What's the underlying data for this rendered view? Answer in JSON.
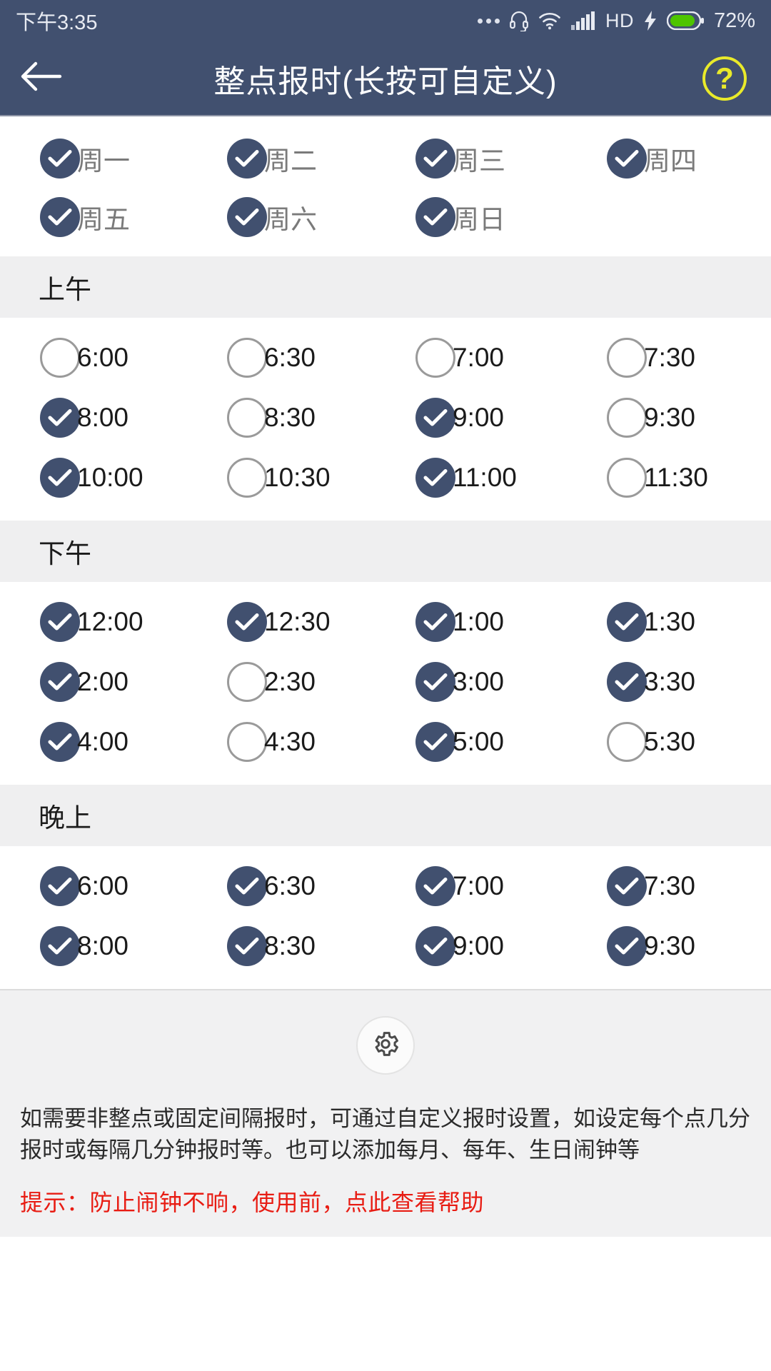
{
  "statusbar": {
    "time": "下午3:35",
    "icons": [
      "more-dots-icon",
      "headset-icon",
      "wifi-icon",
      "signal-bars-icon",
      "hd-icon",
      "charging-bolt-icon",
      "battery-icon"
    ],
    "hd_label": "HD",
    "battery_percent": "72%",
    "battery_color": "#4ec400",
    "bg_color": "#41506f",
    "text_color": "#e8ebf2"
  },
  "appbar": {
    "title": "整点报时(长按可自定义)",
    "back_icon": "back-arrow-icon",
    "help_label": "?",
    "help_color": "#e9ea2a",
    "bg_color": "#41506f"
  },
  "theme": {
    "accent": "#41506f",
    "section_bg": "#efeff0",
    "footer_bg": "#f1f1f2",
    "unchecked_border": "#9a9a9a",
    "tip_color": "#e81c13",
    "day_label_color": "#7a7a7a"
  },
  "weekdays": [
    {
      "label": "周一",
      "checked": true
    },
    {
      "label": "周二",
      "checked": true
    },
    {
      "label": "周三",
      "checked": true
    },
    {
      "label": "周四",
      "checked": true
    },
    {
      "label": "周五",
      "checked": true
    },
    {
      "label": "周六",
      "checked": true
    },
    {
      "label": "周日",
      "checked": true
    }
  ],
  "sections": [
    {
      "title": "上午",
      "times": [
        {
          "label": "6:00",
          "checked": false
        },
        {
          "label": "6:30",
          "checked": false
        },
        {
          "label": "7:00",
          "checked": false
        },
        {
          "label": "7:30",
          "checked": false
        },
        {
          "label": "8:00",
          "checked": true
        },
        {
          "label": "8:30",
          "checked": false
        },
        {
          "label": "9:00",
          "checked": true
        },
        {
          "label": "9:30",
          "checked": false
        },
        {
          "label": "10:00",
          "checked": true
        },
        {
          "label": "10:30",
          "checked": false
        },
        {
          "label": "11:00",
          "checked": true
        },
        {
          "label": "11:30",
          "checked": false
        }
      ]
    },
    {
      "title": "下午",
      "times": [
        {
          "label": "12:00",
          "checked": true
        },
        {
          "label": "12:30",
          "checked": true
        },
        {
          "label": "1:00",
          "checked": true
        },
        {
          "label": "1:30",
          "checked": true
        },
        {
          "label": "2:00",
          "checked": true
        },
        {
          "label": "2:30",
          "checked": false
        },
        {
          "label": "3:00",
          "checked": true
        },
        {
          "label": "3:30",
          "checked": true
        },
        {
          "label": "4:00",
          "checked": true
        },
        {
          "label": "4:30",
          "checked": false
        },
        {
          "label": "5:00",
          "checked": true
        },
        {
          "label": "5:30",
          "checked": false
        }
      ]
    },
    {
      "title": "晚上",
      "times": [
        {
          "label": "6:00",
          "checked": true
        },
        {
          "label": "6:30",
          "checked": true
        },
        {
          "label": "7:00",
          "checked": true
        },
        {
          "label": "7:30",
          "checked": true
        },
        {
          "label": "8:00",
          "checked": true
        },
        {
          "label": "8:30",
          "checked": true
        },
        {
          "label": "9:00",
          "checked": true
        },
        {
          "label": "9:30",
          "checked": true
        }
      ]
    }
  ],
  "footer": {
    "gear_icon": "gear-icon",
    "description": "如需要非整点或固定间隔报时，可通过自定义报时设置，如设定每个点几分报时或每隔几分钟报时等。也可以添加每月、每年、生日闹钟等",
    "tip": "提示：防止闹钟不响，使用前，点此查看帮助"
  }
}
